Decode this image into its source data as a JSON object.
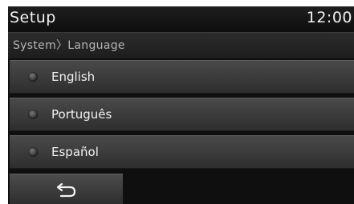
{
  "header": {
    "title": "Setup",
    "clock": "12:00"
  },
  "breadcrumb": "System〉Language",
  "languages": [
    {
      "label": "English",
      "selected": false
    },
    {
      "label": "Português",
      "selected": false
    },
    {
      "label": "Español",
      "selected": false
    }
  ],
  "footer": {
    "back_icon": "back-arrow-icon"
  }
}
